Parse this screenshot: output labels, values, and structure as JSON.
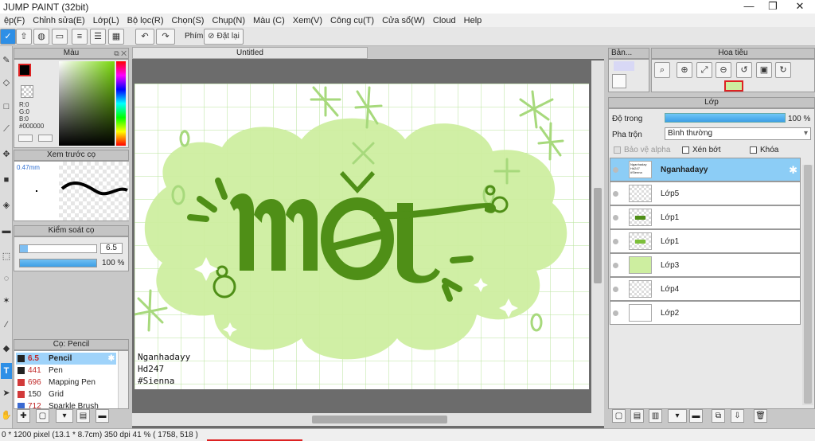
{
  "window": {
    "title": "JUMP PAINT (32bit)",
    "minimize": "—",
    "maximize": "❐",
    "close": "✕"
  },
  "menu": [
    "ệp(F)",
    "Chỉnh sửa(E)",
    "Lớp(L)",
    "Bộ lọc(R)",
    "Chọn(S)",
    "Chụp(N)",
    "Màu (C)",
    "Xem(V)",
    "Công cụ(T)",
    "Cửa sổ(W)",
    "Cloud",
    "Help"
  ],
  "toolbar": {
    "shortcut_label": "Phím",
    "reset_label": "Đặt lại"
  },
  "color_panel": {
    "title": "Màu",
    "r": "R:0",
    "g": "G:0",
    "b": "B:0",
    "hex": "#000000"
  },
  "brush_preview": {
    "title": "Xem trước cọ",
    "size": "0.47mm"
  },
  "brush_control": {
    "title": "Kiểm soát cọ",
    "size_value": "6.5",
    "opacity_value": "100 %"
  },
  "brush_list": {
    "title": "Cọ: Pencil",
    "items": [
      {
        "size": "6.5",
        "name": "Pencil",
        "color": "#c02828"
      },
      {
        "size": "441",
        "name": "Pen",
        "color": "#d23a3a"
      },
      {
        "size": "696",
        "name": "Mapping Pen",
        "color": "#d23a3a"
      },
      {
        "size": "150",
        "name": "Grid",
        "color": "#d23a3a"
      },
      {
        "size": "712",
        "name": "Sparkle Brush",
        "color": "#3a6ad2"
      }
    ]
  },
  "document": {
    "tab_title": "Untitled"
  },
  "artwork": {
    "caption": [
      "Nganhadayy",
      "Hd247",
      "#Sienna"
    ]
  },
  "canvas_panel": {
    "title": "Bản..."
  },
  "navigator": {
    "title": "Hoa tiêu"
  },
  "layers_panel": {
    "title": "Lớp",
    "opacity_label": "Độ trong",
    "opacity_value": "100 %",
    "blend_label": "Pha trộn",
    "blend_value": "Bình thường",
    "protect_alpha": "Bảo vệ alpha",
    "clipping": "Xén bớt",
    "lock": "Khóa",
    "layers": [
      {
        "name": "Nganhadayy",
        "thumb_text": "Nganhaday Hd247 #Sienna",
        "selected": true
      },
      {
        "name": "Lớp5",
        "selected": false
      },
      {
        "name": "Lớp1",
        "selected": false
      },
      {
        "name": "Lớp1",
        "selected": false
      },
      {
        "name": "Lớp3",
        "selected": false
      },
      {
        "name": "Lớp4",
        "selected": false
      },
      {
        "name": "Lớp2",
        "selected": false
      }
    ]
  },
  "status": {
    "text": "0 * 1200 pixel  (13.1 * 8.7cm)  350 dpi  41 %  ( 1758, 518 )"
  }
}
